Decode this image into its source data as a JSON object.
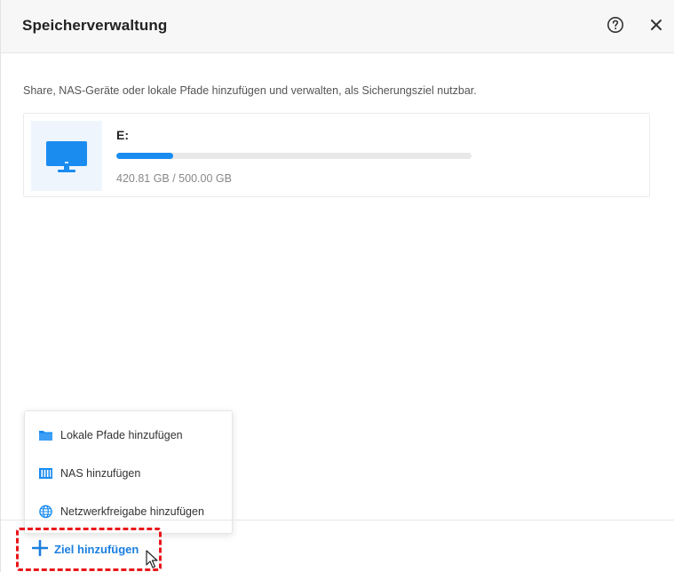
{
  "dialog": {
    "title": "Speicherverwaltung",
    "description": "Share, NAS-Geräte oder lokale Pfade hinzufügen und verwalten, als Sicherungsziel nutzbar."
  },
  "header_icons": {
    "help": "help-icon",
    "close": "close-icon"
  },
  "drive": {
    "name": "E:",
    "size": "420.81 GB / 500.00 GB",
    "progress_fraction": 0.16,
    "icon": "monitor-icon"
  },
  "menu": {
    "items": [
      {
        "label": "Lokale Pfade hinzufügen",
        "icon": "folder-icon"
      },
      {
        "label": "NAS hinzufügen",
        "icon": "nas-icon"
      },
      {
        "label": "Netzwerkfreigabe hinzufügen",
        "icon": "globe-icon"
      }
    ]
  },
  "footer": {
    "add_label": "Ziel hinzufügen",
    "add_icon": "plus-icon"
  },
  "colors": {
    "accent": "#1a8cf0",
    "link": "#1a7fe0",
    "highlight": "#e8161b",
    "header_bg": "#f7f7f7"
  }
}
